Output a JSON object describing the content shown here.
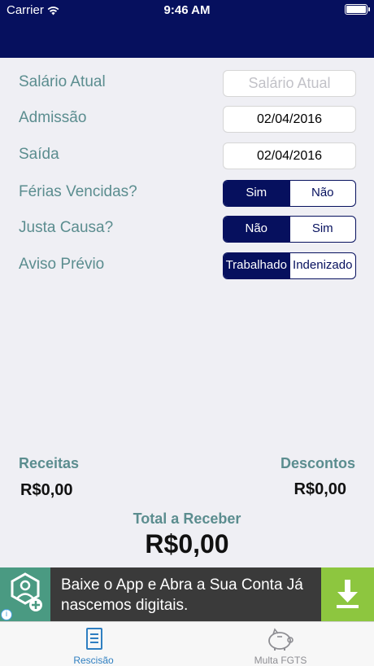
{
  "status_bar": {
    "carrier": "Carrier",
    "time": "9:46 AM"
  },
  "form": {
    "salario": {
      "label": "Salário Atual",
      "placeholder": "Salário Atual"
    },
    "admissao": {
      "label": "Admissão",
      "value": "02/04/2016"
    },
    "saida": {
      "label": "Saída",
      "value": "02/04/2016"
    },
    "ferias": {
      "label": "Férias Vencidas?",
      "options": [
        "Sim",
        "Não"
      ],
      "selected": "Sim"
    },
    "justa": {
      "label": "Justa Causa?",
      "options": [
        "Não",
        "Sim"
      ],
      "selected": "Não"
    },
    "aviso": {
      "label": "Aviso Prévio",
      "options": [
        "Trabalhado",
        "Indenizado"
      ],
      "selected": "Trabalhado"
    }
  },
  "totals": {
    "receitas_label": "Receitas",
    "receitas_value": "R$0,00",
    "descontos_label": "Descontos",
    "descontos_value": "R$0,00",
    "total_label": "Total a Receber",
    "total_value": "R$0,00"
  },
  "ad": {
    "line1": "Baixe o App e Abra a Sua Conta Já",
    "line2": "nascemos digitais."
  },
  "tabs": [
    {
      "label": "Rescisão",
      "active": true
    },
    {
      "label": "Multa FGTS",
      "active": false
    }
  ],
  "colors": {
    "nav": "#06105e",
    "label": "#5b8d8f",
    "tab_active": "#2f7fc1",
    "tab_inactive": "#8e8e93"
  }
}
